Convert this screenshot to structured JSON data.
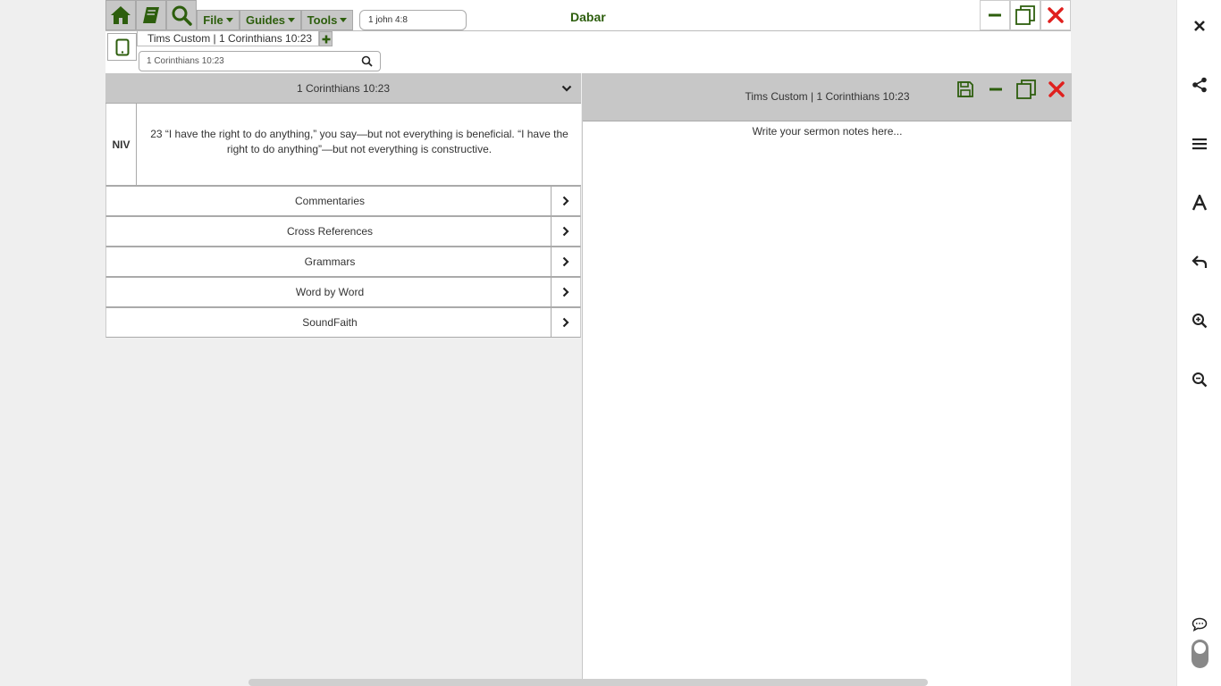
{
  "topbar": {
    "menus": [
      {
        "label": "File"
      },
      {
        "label": "Guides"
      },
      {
        "label": "Tools"
      }
    ],
    "reference_input_value": "1 john 4:8",
    "app_title": "Dabar"
  },
  "tabs": {
    "active_tab_label": "Tims Custom | 1 Corinthians 10:23",
    "search_value": "1 Corinthians 10:23"
  },
  "left_pane": {
    "header": "1 Corinthians 10:23",
    "version": "NIV",
    "verse_text": "23 “I have the right to do anything,” you say—but not everything is beneficial. “I have the right to do anything”—but not everything is constructive.",
    "sections": [
      {
        "label": "Commentaries"
      },
      {
        "label": "Cross References"
      },
      {
        "label": "Grammars"
      },
      {
        "label": "Word by Word"
      },
      {
        "label": "SoundFaith"
      }
    ]
  },
  "right_pane": {
    "title": "Tims Custom | 1 Corinthians 10:23",
    "placeholder": "Write your sermon notes here..."
  },
  "colors": {
    "brand_green": "#2d5e0d",
    "close_red": "#e0201e",
    "toolbar_gray": "#c7c7c7"
  }
}
